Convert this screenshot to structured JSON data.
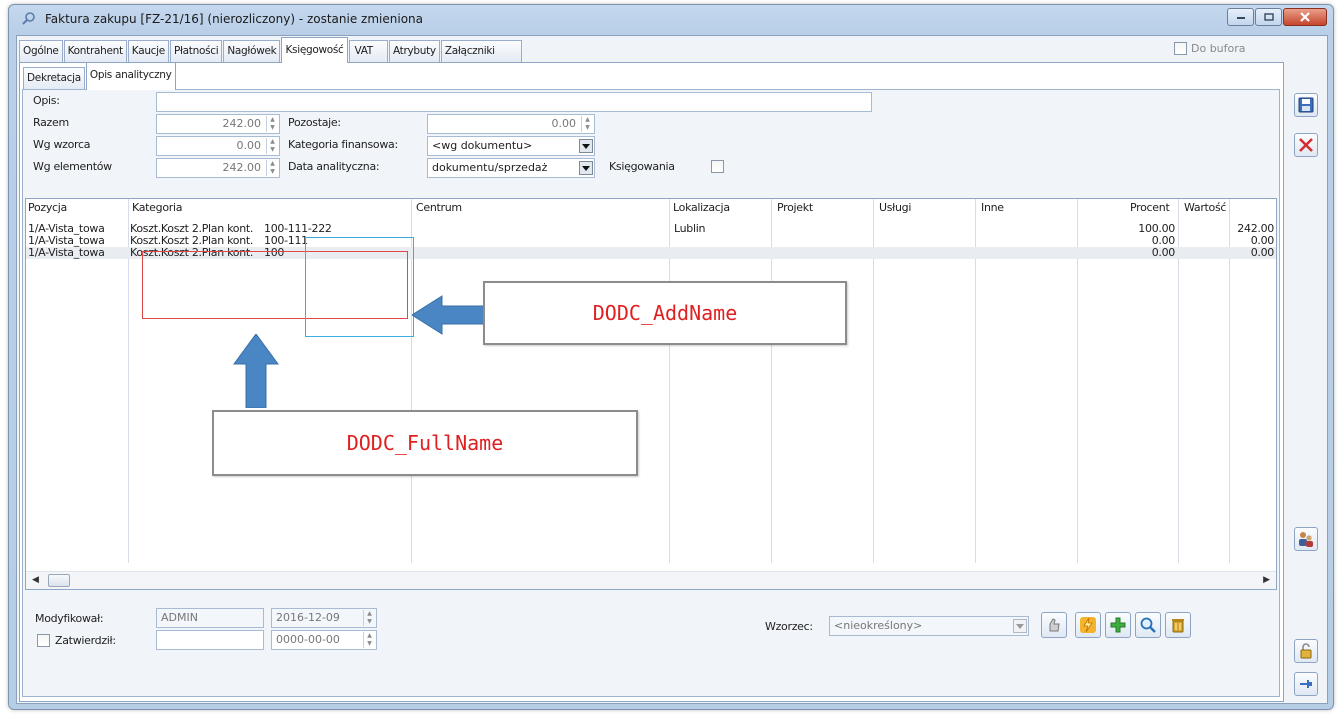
{
  "window": {
    "title": "Faktura zakupu [FZ-21/16] (nierozliczony) - zostanie zmieniona"
  },
  "tabs": [
    {
      "label": "Ogólne"
    },
    {
      "label": "Kontrahent"
    },
    {
      "label": "Kaucje"
    },
    {
      "label": "Płatności"
    },
    {
      "label": "Nagłówek"
    },
    {
      "label": "Księgowość",
      "active": true
    },
    {
      "label": "VAT"
    },
    {
      "label": "Atrybuty"
    },
    {
      "label": "Załączniki"
    }
  ],
  "do_bufora": {
    "label": "Do bufora",
    "checked": false
  },
  "subtabs": [
    {
      "label": "Dekretacja"
    },
    {
      "label": "Opis analityczny",
      "active": true
    }
  ],
  "form": {
    "opis": {
      "label": "Opis:",
      "value": ""
    },
    "razem": {
      "label": "Razem",
      "value": "242.00"
    },
    "pozostaje": {
      "label": "Pozostaje:",
      "value": "0.00"
    },
    "wg_wzorca": {
      "label": "Wg wzorca",
      "value": "0.00"
    },
    "kategoria_finansowa": {
      "label": "Kategoria finansowa:",
      "value": "<wg dokumentu>"
    },
    "wg_elementow": {
      "label": "Wg elementów",
      "value": "242.00"
    },
    "data_analityczna": {
      "label": "Data analityczna:",
      "value": "dokumentu/sprzedaż"
    },
    "ksiegowania": {
      "label": "Księgowania",
      "checked": false
    }
  },
  "grid": {
    "columns": [
      "Pozycja",
      "Kategoria",
      "Centrum",
      "Lokalizacja",
      "Projekt",
      "Usługi",
      "Inne",
      "Procent",
      "Wartość"
    ],
    "rows": [
      {
        "pozycja": "1/A-Vista_towa",
        "kategoria": "Koszt.Koszt 2.Plan kont.",
        "addname": "100-111-222",
        "lokalizacja": "Lublin",
        "procent": "100.00",
        "wartosc": "242.00"
      },
      {
        "pozycja": "1/A-Vista_towa",
        "kategoria": "Koszt.Koszt 2.Plan kont.",
        "addname": "100-111",
        "lokalizacja": "",
        "procent": "0.00",
        "wartosc": "0.00"
      },
      {
        "pozycja": "1/A-Vista_towa",
        "kategoria": "Koszt.Koszt 2.Plan kont.",
        "addname": "100",
        "lokalizacja": "",
        "procent": "0.00",
        "wartosc": "0.00"
      }
    ]
  },
  "footer": {
    "modyfikowal": {
      "label": "Modyfikował:",
      "user": "ADMIN",
      "date": "2016-12-09"
    },
    "zatwierdzil": {
      "label": "Zatwierdził:",
      "user": "",
      "date": "0000-00-00",
      "checked": false
    },
    "wzorzec": {
      "label": "Wzorzec:",
      "value": "<nieokreślony>"
    }
  },
  "annotations": {
    "addname": "DODC_AddName",
    "fullname": "DODC_FullName",
    "colors": {
      "fullname_box": "#e04848",
      "addname_box": "#3aaee0",
      "arrow": "#4a86c4"
    }
  }
}
